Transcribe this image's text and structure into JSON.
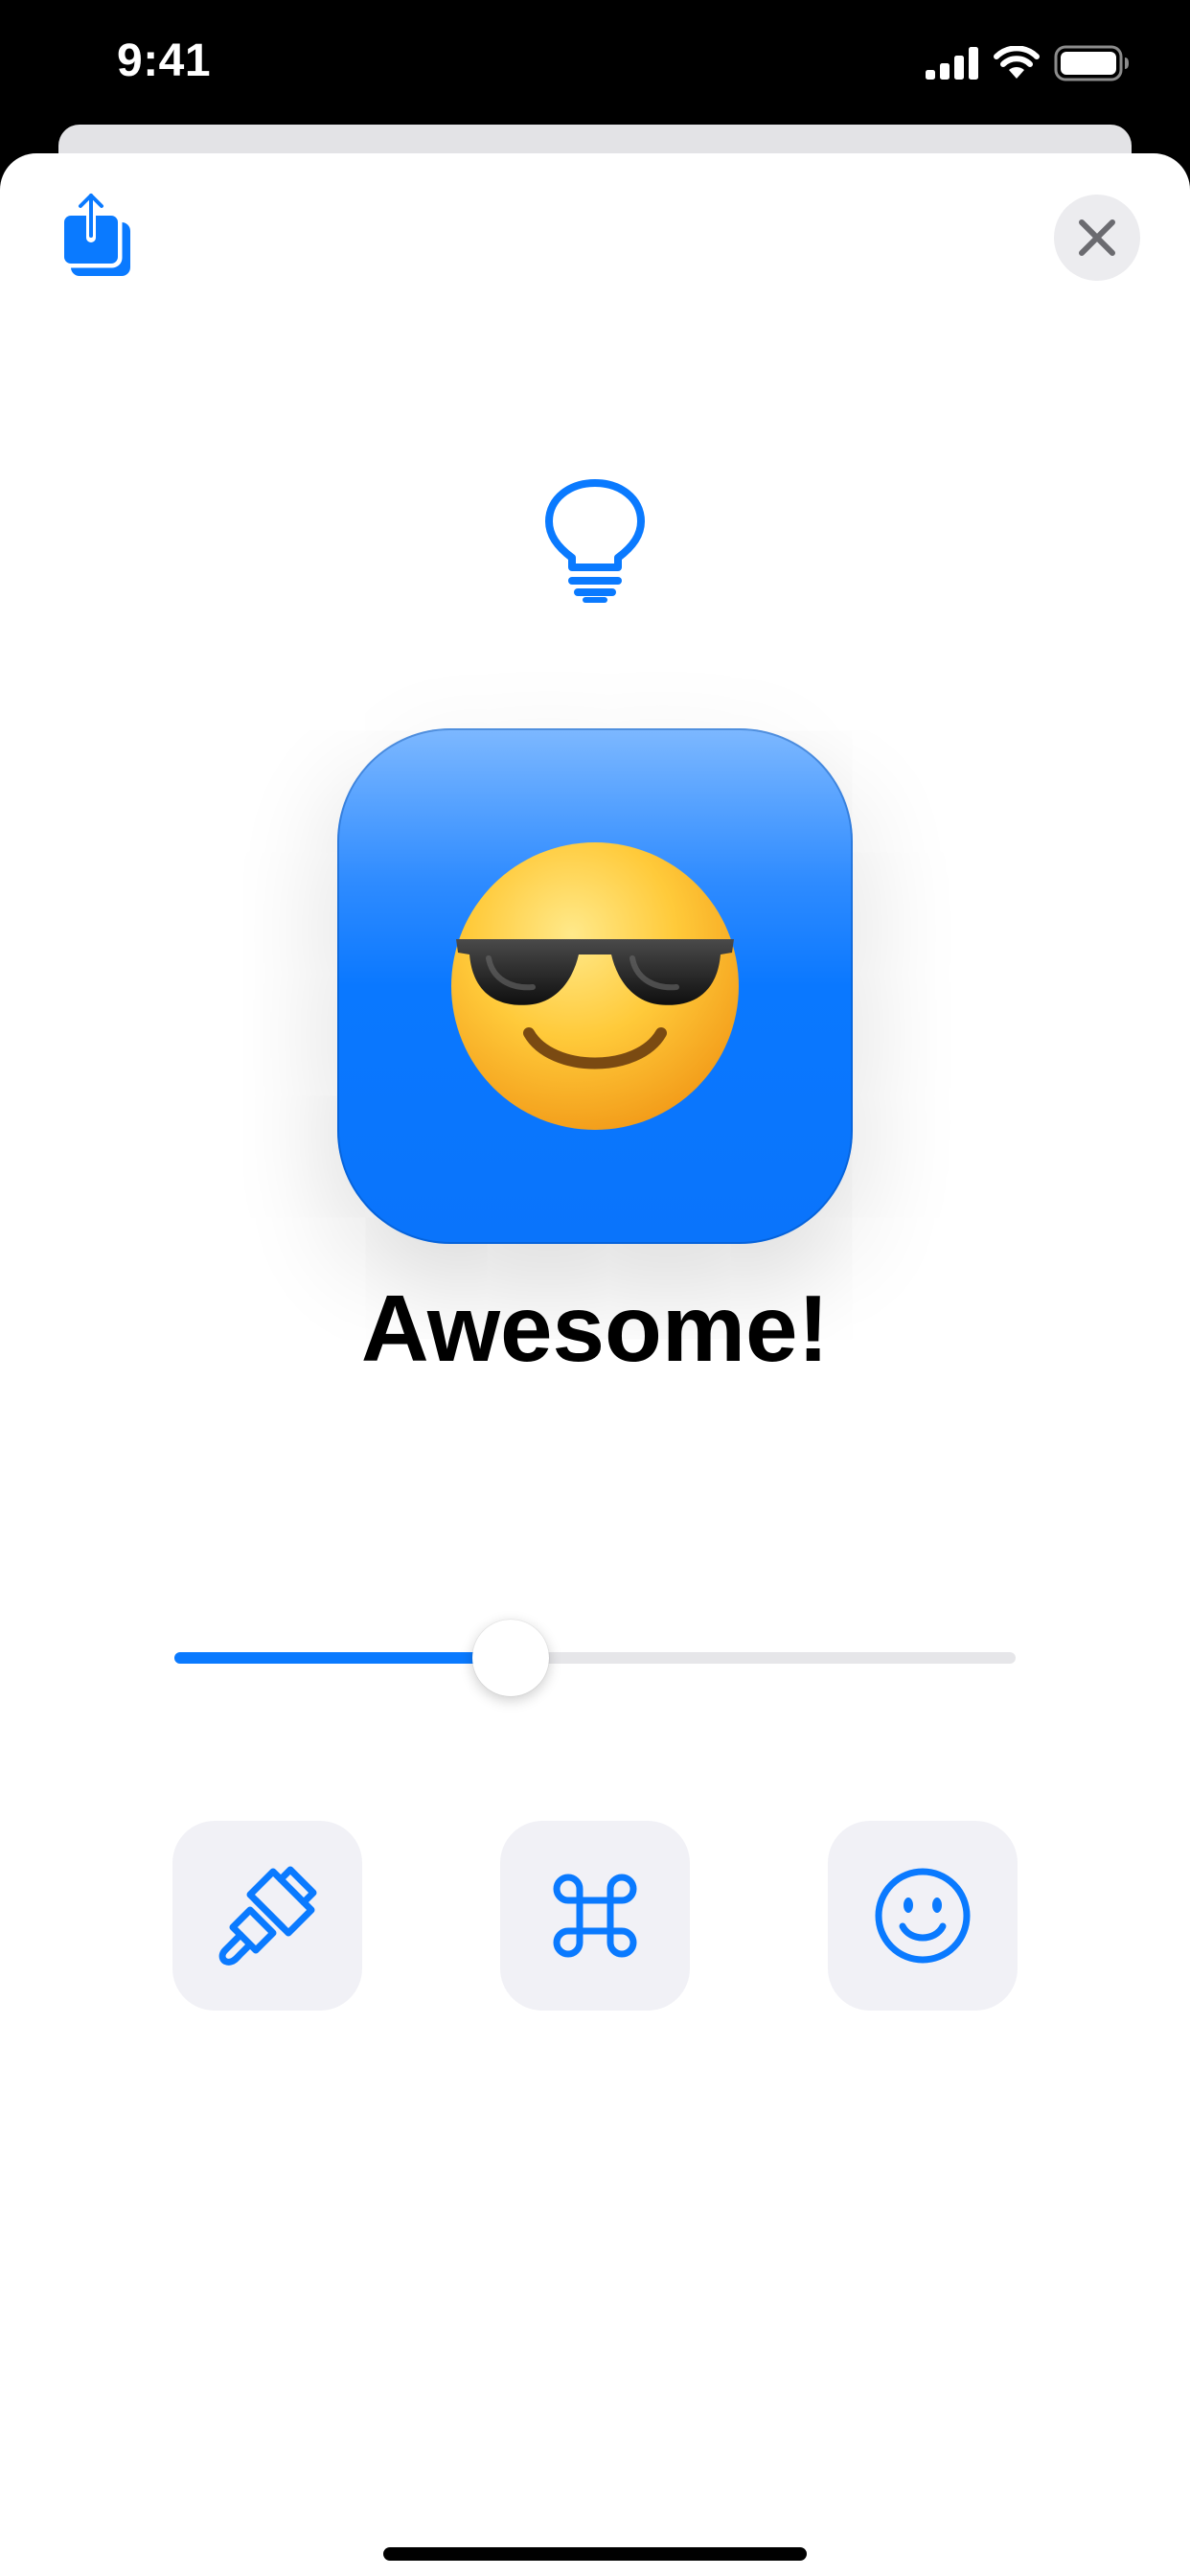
{
  "status_bar": {
    "time": "9:41"
  },
  "icons": {
    "share": "share-icon",
    "close": "close-icon",
    "bulb": "lightbulb-icon",
    "emoji": "smiling-face-with-sunglasses-emoji",
    "paint": "paintbrush-icon",
    "command": "command-icon",
    "smiley": "smiley-face-icon"
  },
  "title": "Awesome!",
  "slider": {
    "value": 0.4
  },
  "colors": {
    "accent": "#0a7aff",
    "tile_top": "#7db8ff",
    "tile": "#0a78ff",
    "tool_background": "#f1f1f6",
    "close_background": "#ececef"
  }
}
